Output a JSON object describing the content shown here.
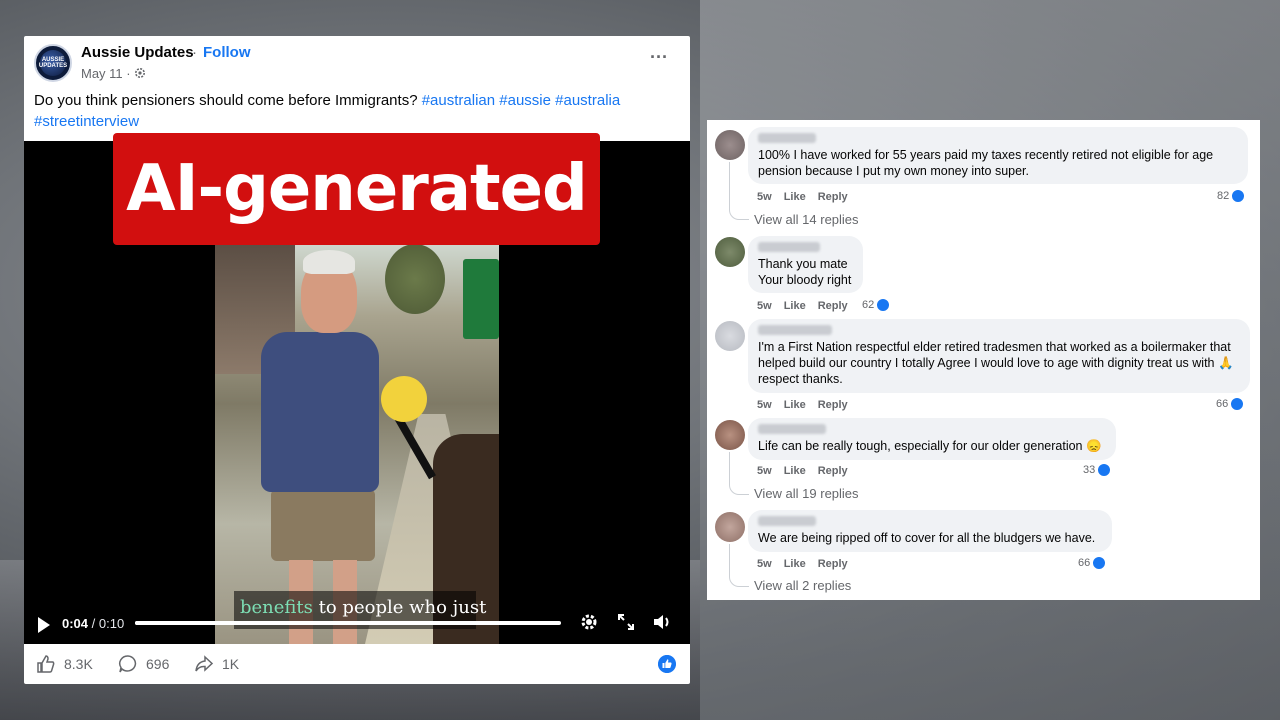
{
  "post": {
    "page_name": "Aussie Updates",
    "separator": "·",
    "follow_label": "Follow",
    "date": "May 11 ·",
    "avatar_text": "AUSSIE UPDATES",
    "text_main": "Do you think pensioners should come before Immigrants?",
    "hashtags": [
      "#australian",
      "#aussie",
      "#australia",
      "#streetinterview"
    ],
    "more_icon": "more-horizontal-icon"
  },
  "video": {
    "badge_label": "AI-generated",
    "caption_highlight": "benefits",
    "caption_rest": "to people who just",
    "time_current": "0:04",
    "time_sep": " / ",
    "time_total": "0:10",
    "progress": 0.4
  },
  "footer": {
    "likes": "8.3K",
    "comments": "696",
    "shares": "1K"
  },
  "comments": [
    {
      "text": "100% I have worked for 55 years paid my taxes recently retired not eligible for age pension because I put my own money into super.",
      "age": "5w",
      "like_label": "Like",
      "reply_label": "Reply",
      "reaction_count": "82",
      "replies_label": "View all 14 replies"
    },
    {
      "text_line1": "Thank you mate",
      "text_line2": "Your bloody right",
      "age": "5w",
      "like_label": "Like",
      "reply_label": "Reply",
      "reaction_count": "62"
    },
    {
      "text": "I'm a First Nation respectful elder retired tradesmen that worked as a boilermaker that helped build our country I totally Agree I would love to age with dignity treat us with 🙏 respect thanks.",
      "age": "5w",
      "like_label": "Like",
      "reply_label": "Reply",
      "reaction_count": "66"
    },
    {
      "text": "Life can be really tough, especially for our older generation 😞",
      "age": "5w",
      "like_label": "Like",
      "reply_label": "Reply",
      "reaction_count": "33",
      "replies_label": "View all 19 replies"
    },
    {
      "text": "We are being ripped off to cover for all the bludgers we have.",
      "age": "5w",
      "like_label": "Like",
      "reply_label": "Reply",
      "reaction_count": "66",
      "replies_label": "View all 2 replies"
    }
  ],
  "colors": {
    "accent": "#1877f2",
    "badge": "#d20f0f",
    "bubble": "#f0f2f5"
  }
}
